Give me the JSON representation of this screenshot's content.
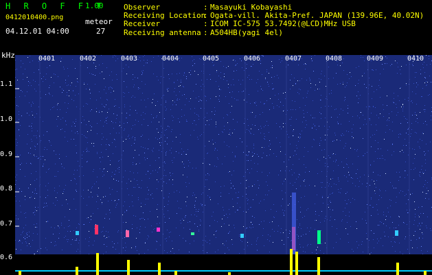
{
  "header": {
    "app_title": "H R O F F T",
    "app_version": "1.00",
    "file_name": "0412010400.png",
    "meteor_label": "meteor",
    "meteor_count": "27",
    "datetime": "04.12.01 04:00",
    "info": [
      {
        "label": "Observer",
        "value": "Masayuki Kobayashi"
      },
      {
        "label": "Receiving Location",
        "value": "Ogata-vill. Akita-Pref. JAPAN (139.96E, 40.02N)"
      },
      {
        "label": "Receiver",
        "value": "ICOM IC-575 53.7492(@LCD)MHz USB"
      },
      {
        "label": "Receiving antenna",
        "value": "A504HB(yagi 4el)"
      }
    ]
  },
  "axis": {
    "unit": "kHz",
    "y_ticks": [
      "1.1",
      "1.0",
      "0.9",
      "0.8",
      "0.7",
      "0.6"
    ],
    "x_ticks": [
      "0401",
      "0402",
      "0403",
      "0404",
      "0405",
      "0406",
      "0407",
      "0408",
      "0409",
      "0410"
    ]
  },
  "colors": {
    "background": "#000000",
    "spectrogram_base": "#1a2a78",
    "header_green": "#00ff00",
    "header_yellow": "#ffff00",
    "meteor_bars": "#ffff00",
    "noise_floor": "#00cfff"
  }
}
